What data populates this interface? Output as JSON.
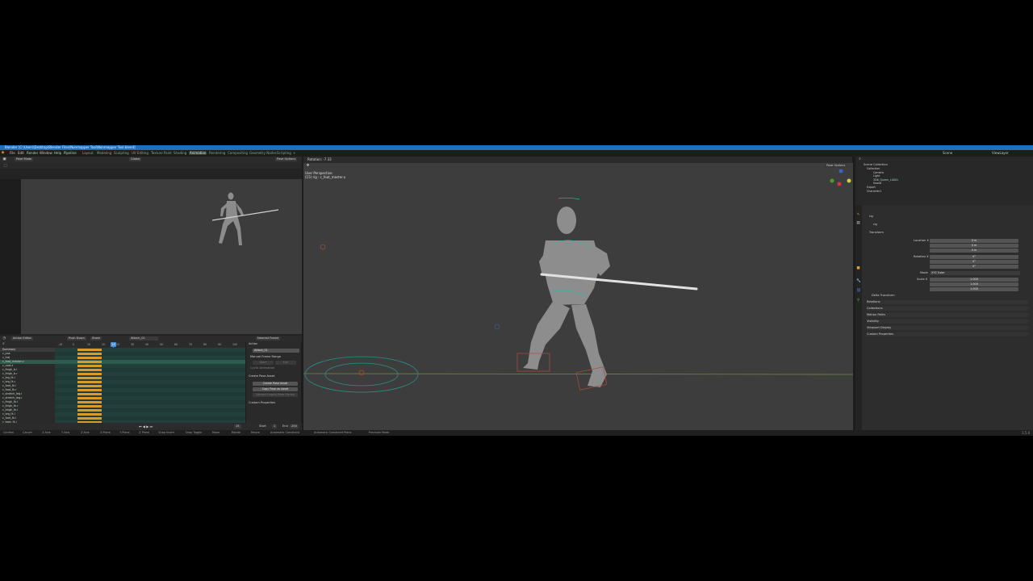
{
  "title_bar": {
    "text": "Blender [C:\\Users\\Desktop\\Blender Files\\Nonmapper Tool\\Nonmapper Tool.blend]"
  },
  "menu": {
    "items": [
      "File",
      "Edit",
      "Render",
      "Window",
      "Help",
      "Pipeline"
    ],
    "workspaces": [
      "Layout",
      "Modeling",
      "Sculpting",
      "UV Editing",
      "Texture Paint",
      "Shading",
      "Animation",
      "Rendering",
      "Compositing",
      "Geometry Nodes",
      "Scripting",
      "+"
    ],
    "active_workspace": "Animation",
    "scene_label": "Scene",
    "view_layer_label": "ViewLayer"
  },
  "left_viewport": {
    "mode_label": "Pose Mode",
    "transform_orientation": "Global",
    "pose_options": "Pose Options"
  },
  "main_viewport": {
    "operator_hint": "Rotation: -7.33",
    "view_name": "User Perspective",
    "object_info": "(15) rig : c_foot_master.x",
    "pose_options": "Pose Options"
  },
  "action_editor": {
    "editor_label": "Action Editor",
    "push_down": "Push Down",
    "stash": "Stash",
    "action_name": "Attack_01",
    "snap_label": "Nearest Frame",
    "frame_ticks": [
      "-10",
      "0",
      "10",
      "15",
      "20",
      "30",
      "40",
      "50",
      "60",
      "70",
      "80",
      "90",
      "100"
    ],
    "current_frame": "15",
    "channels": [
      "Summary",
      "c_pos",
      "c_traj",
      "c_foot_master.x",
      "c_root.x",
      "c_thigh_b.l",
      "c_thigh_b.r",
      "c_leg_fk.l",
      "c_leg_fk.r",
      "c_foot_fk.l",
      "c_foot_fk.r",
      "c_stretch_leg.l",
      "c_stretch_leg.r",
      "c_thigh_fk.l",
      "c_thigh_fk.r",
      "c_thigh_fk.l",
      "c_leg_fk.l",
      "c_foot_fk.l",
      "c_toes_fk.l"
    ],
    "playback": {
      "current": "15",
      "start_label": "Start",
      "start": "1",
      "end_label": "End",
      "end": "250"
    }
  },
  "action_sidebar": {
    "action_header": "Action",
    "action_name": "Attack_01",
    "manual_range": "Manual Frame Range",
    "start_label": "Start",
    "end_label": "End",
    "cyclic": "Cyclic Animation",
    "create_pose_header": "Create Pose Asset",
    "create_pose_btn": "Create Pose Asset",
    "copy_pose_btn": "Copy Pose as Asset",
    "legacy_btn": "Convert Legacy Pose Library",
    "custom_props": "Custom Properties"
  },
  "outliner": {
    "root": "Scene Collection",
    "items": [
      "Collection",
      "Camera",
      "Light",
      "3D6_Queen_L0001",
      "Sword",
      "Export",
      "Character1"
    ]
  },
  "properties": {
    "object_name": "rig",
    "sub_name": "rig",
    "transform_header": "Transform",
    "location_label": "Location X",
    "location": [
      "0 m",
      "0 m",
      "0 m"
    ],
    "rotation_label": "Rotation X",
    "rotation": [
      "0°",
      "0°",
      "0°"
    ],
    "mode_label": "Mode",
    "mode_value": "XYZ Euler",
    "scale_label": "Scale X",
    "scale": [
      "1.000",
      "1.000",
      "1.000"
    ],
    "panels": [
      "Delta Transform",
      "Relations",
      "Collections",
      "Motion Paths",
      "Visibility",
      "Viewport Display",
      "Custom Properties"
    ]
  },
  "status_bar": {
    "items": [
      "Confirm",
      "Cancel",
      "X Axis",
      "Y Axis",
      "Z Axis",
      "X Plane",
      "Y Plane",
      "Z Plane",
      "Snap Invert",
      "Snap Toggle",
      "Move",
      "Rotate",
      "Resize",
      "Automatic Constraint",
      "Automatic Constraint Plane",
      "Precision Mode"
    ],
    "version": "3.5.0"
  },
  "colors": {
    "accent_blue": "#1f6fbf",
    "active_orange": "#e8a03c",
    "keyframe": "#d99a2b",
    "selection_green": "#2d5a4a"
  }
}
